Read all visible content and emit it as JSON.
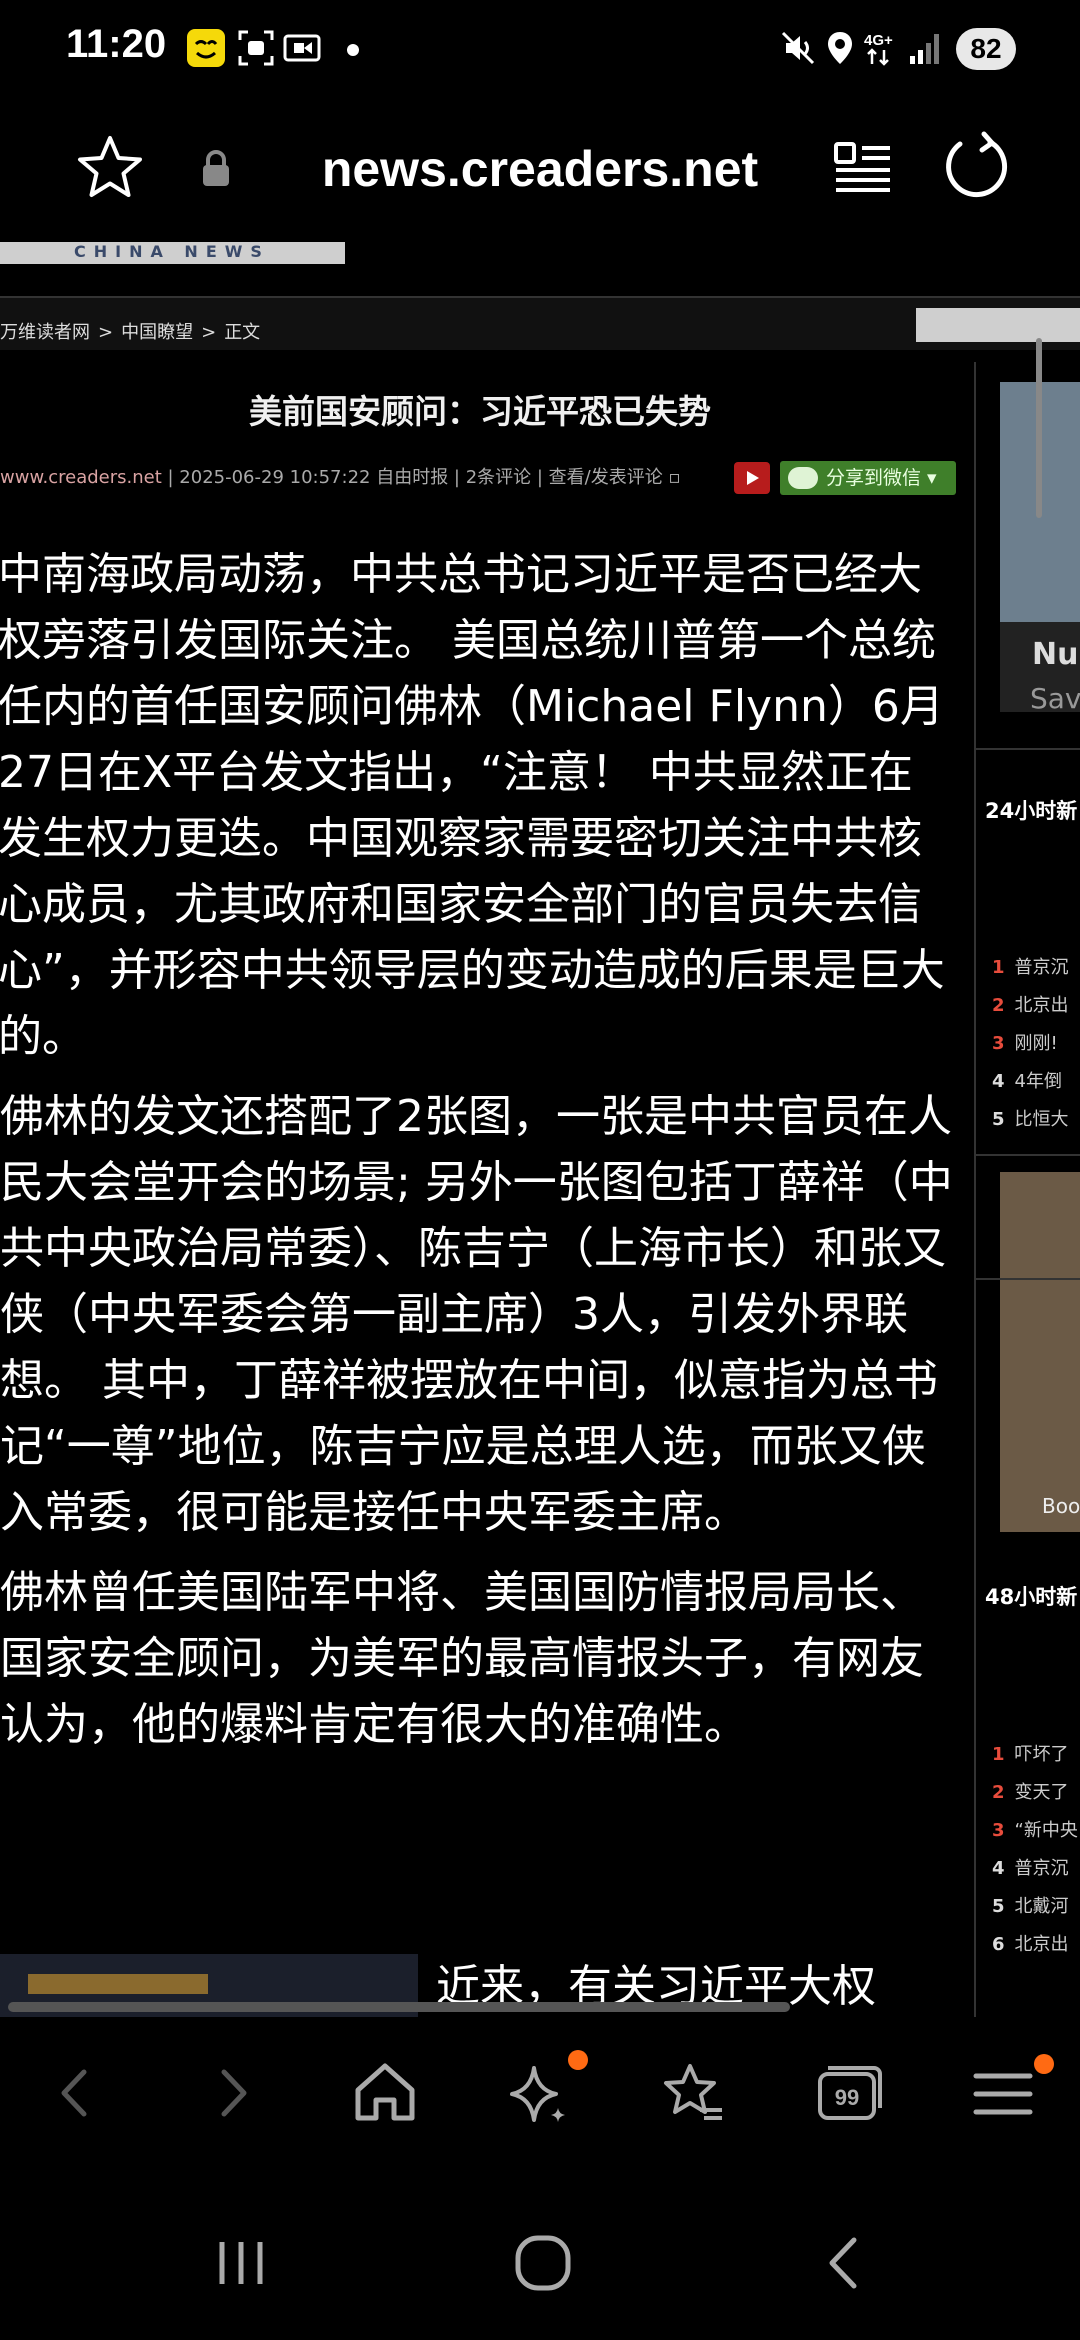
{
  "status": {
    "time": "11:20",
    "battery": "82",
    "network": "4G+"
  },
  "urlbar": {
    "url": "news.creaders.net"
  },
  "page": {
    "banner_text": "CHINA NEWS",
    "breadcrumb": [
      "万维读者网",
      ">",
      "中国瞭望",
      ">",
      "正文"
    ],
    "title": "美前国安顾问：习近平恐已失势",
    "meta_site": "www.creaders.net",
    "meta_rest": "| 2025-06-29 10:57:22  自由时报 | 2条评论 | 查看/发表评论 ▫",
    "share_label": "分享到微信 ▾",
    "paragraphs": [
      "中南海政局动荡，中共总书记习近平是否已经大权旁落引发国际关注。 美国总统川普第一个总统任内的首任国安顾问佛林（Michael Flynn）6月27日在X平台发文指出，“注意！ 中共显然正在发生权力更迭。中国观察家需要密切关注中共核心成员，尤其政府和国家安全部门的官员失去信心”，并形容中共领导层的变动造成的后果是巨大的。",
      "佛林的发文还搭配了2张图，一张是中共官员在人民大会堂开会的场景; 另外一张图包括丁薛祥（中共中央政治局常委）、陈吉宁（上海市长）和张又侠（中央军委会第一副主席）3人，引发外界联想。 其中，丁薛祥被摆放在中间，似意指为总书记“一尊”地位，陈吉宁应是总理人选，而张又侠入常委，很可能是接任中央军委主席。",
      "佛林曾任美国陆军中将、美国国防情报局局长、国家安全顾问，为美军的最高情报头子，有网友认为，他的爆料肯定有很大的准确性。"
    ],
    "tail_text": "近来，有关习近平大权"
  },
  "sidebar": {
    "card_title": "Nur",
    "card_sub": "Sav",
    "h24": "24小时新",
    "list24": [
      {
        "n": "1",
        "t": "普京沉"
      },
      {
        "n": "2",
        "t": "北京出"
      },
      {
        "n": "3",
        "t": "刚刚!"
      },
      {
        "n": "4",
        "t": "4年倒"
      },
      {
        "n": "5",
        "t": "比恒大"
      }
    ],
    "ad_text": "Boo",
    "h48": "48小时新",
    "list48": [
      {
        "n": "1",
        "t": "吓坏了"
      },
      {
        "n": "2",
        "t": "变天了"
      },
      {
        "n": "3",
        "t": "“新中央"
      },
      {
        "n": "4",
        "t": "普京沉"
      },
      {
        "n": "5",
        "t": "北戴河"
      },
      {
        "n": "6",
        "t": "北京出"
      }
    ]
  },
  "colors": {
    "accent_orange": "#ff6a13",
    "rank_red": "#e74c3c",
    "share_green": "#3f7f2a"
  },
  "toolbar": {
    "items": [
      "back-icon",
      "forward-icon",
      "home-icon",
      "ai-sparkle-icon",
      "bookmarks-icon",
      "tabs-icon",
      "menu-icon"
    ],
    "tabs_count": "99"
  },
  "navbar": {
    "items": [
      "recents-icon",
      "home-circle-icon",
      "back-nav-icon"
    ]
  }
}
